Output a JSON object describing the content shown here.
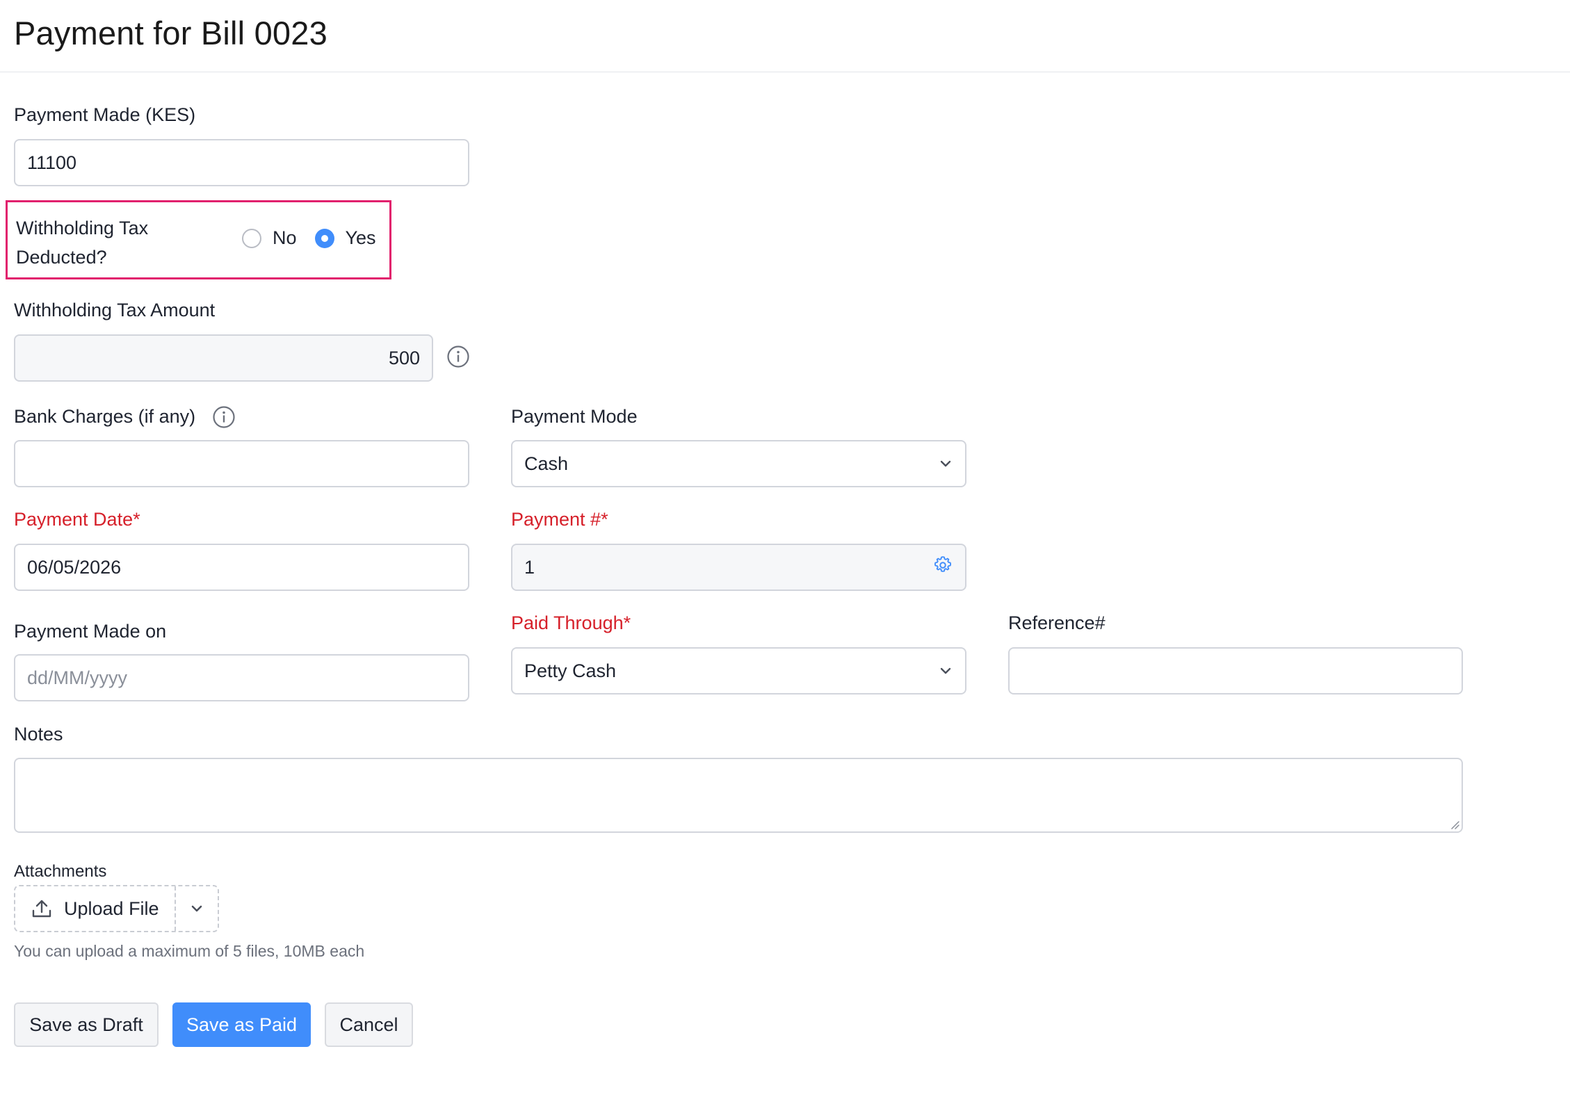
{
  "title": "Payment for Bill 0023",
  "payment_made": {
    "label": "Payment Made (KES)",
    "value": "11100"
  },
  "withholding": {
    "question": "Withholding Tax Deducted?",
    "options": [
      "No",
      "Yes"
    ],
    "selected": "Yes"
  },
  "wht_amount": {
    "label": "Withholding Tax Amount",
    "value": "500"
  },
  "bank_charges": {
    "label": "Bank Charges (if any)",
    "value": ""
  },
  "payment_mode": {
    "label": "Payment Mode",
    "value": "Cash"
  },
  "payment_date": {
    "label": "Payment Date*",
    "value": "06/05/2026"
  },
  "payment_number": {
    "label": "Payment #*",
    "value": "1"
  },
  "payment_made_on": {
    "label": "Payment Made on",
    "placeholder": "dd/MM/yyyy"
  },
  "paid_through": {
    "label": "Paid Through*",
    "value": "Petty Cash"
  },
  "reference": {
    "label": "Reference#",
    "value": ""
  },
  "notes": {
    "label": "Notes",
    "value": ""
  },
  "attachments": {
    "label": "Attachments",
    "upload_label": "Upload File",
    "hint": "You can upload a maximum of 5 files, 10MB each"
  },
  "actions": {
    "save_draft": "Save as Draft",
    "save_paid": "Save as Paid",
    "cancel": "Cancel"
  },
  "colors": {
    "accent": "#408dfb",
    "required": "#d6202a",
    "highlight_border": "#e1206d"
  }
}
